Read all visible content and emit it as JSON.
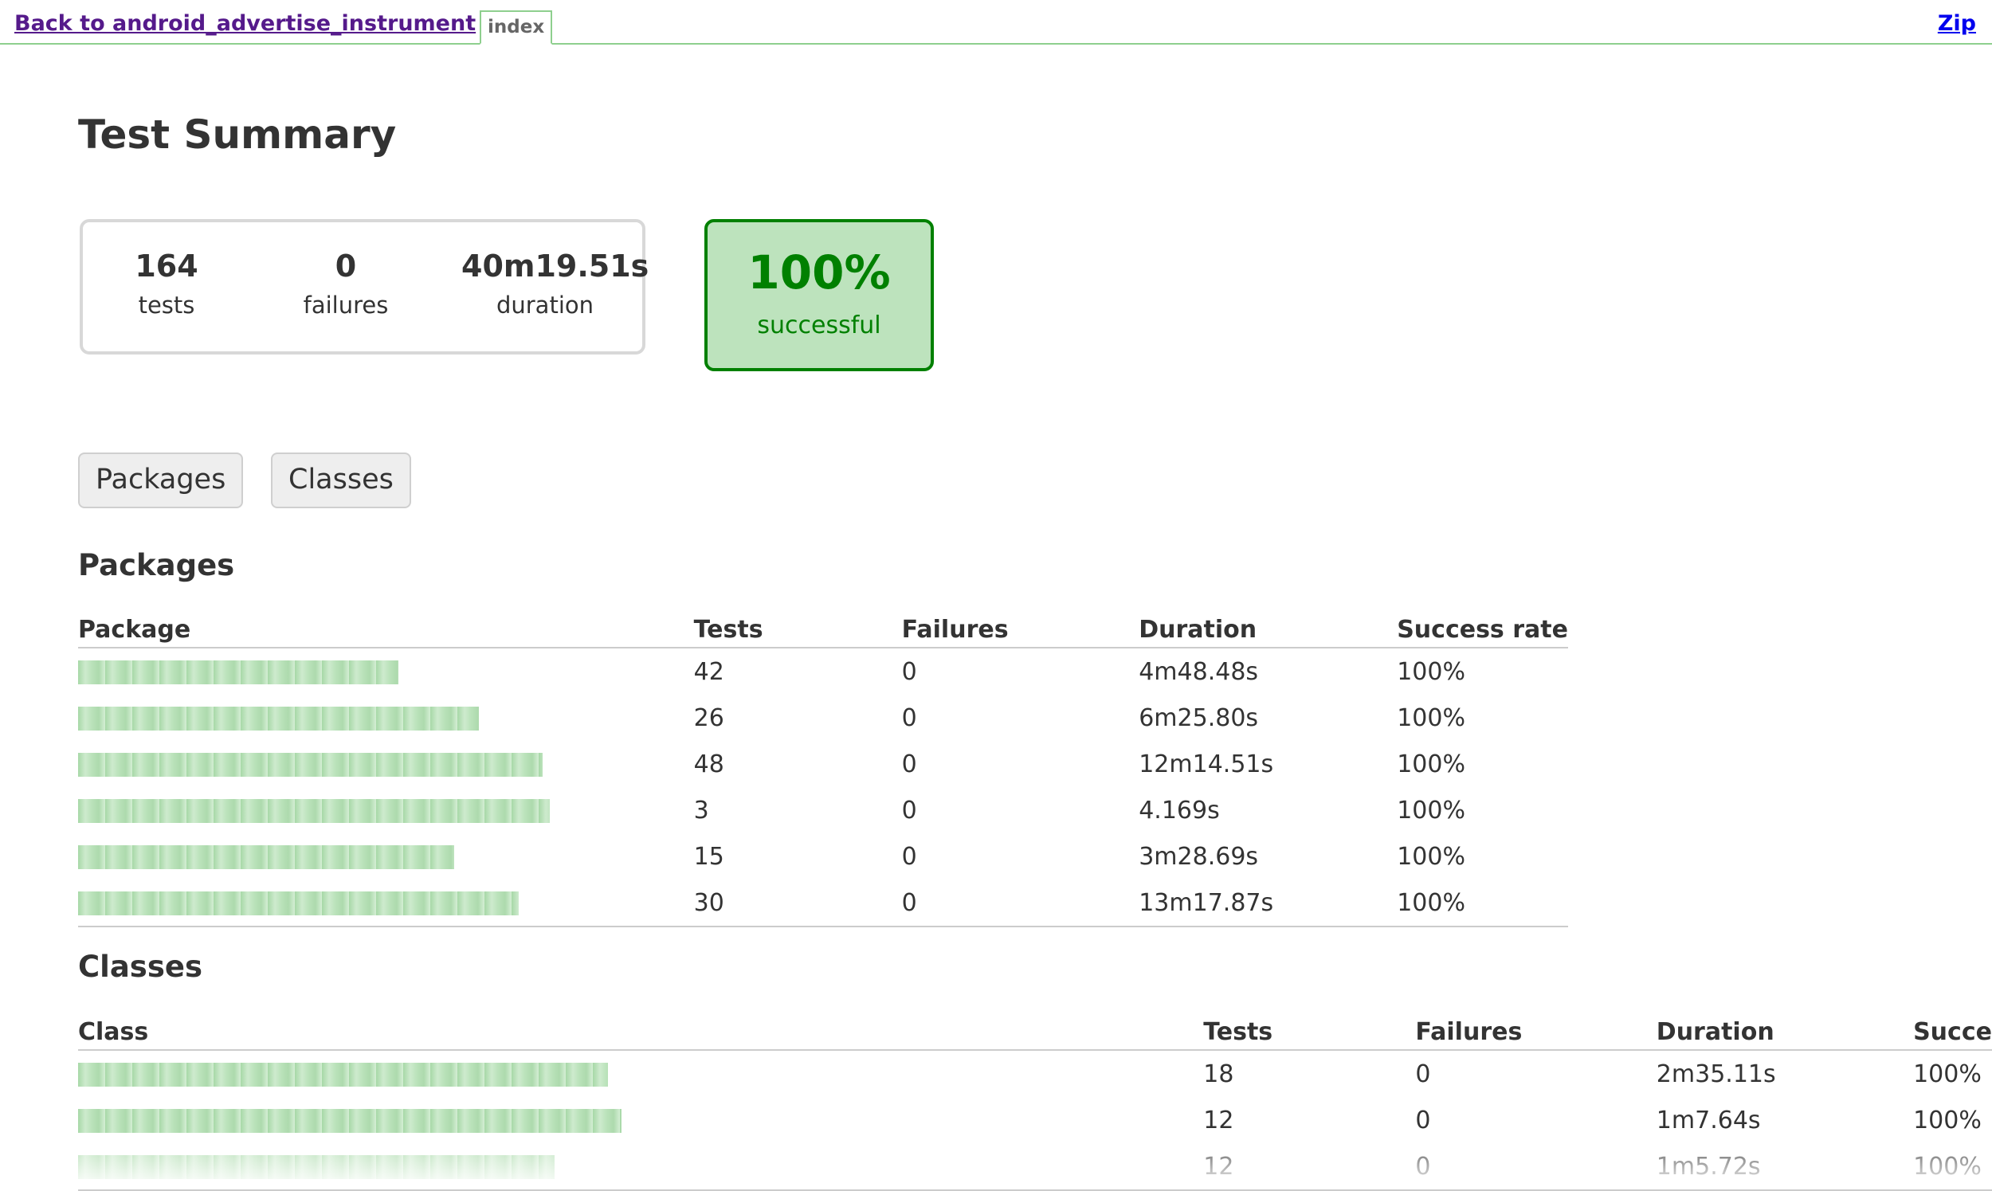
{
  "topbar": {
    "back_link": "Back to android_advertise_instrument",
    "tab_index": "index",
    "zip_link": "Zip"
  },
  "page_title": "Test Summary",
  "summary": {
    "tests": {
      "value": "164",
      "label": "tests"
    },
    "failures": {
      "value": "0",
      "label": "failures"
    },
    "duration": {
      "value": "40m19.51s",
      "label": "duration"
    },
    "success": {
      "value": "100%",
      "label": "successful"
    }
  },
  "tabs": [
    "Packages",
    "Classes"
  ],
  "packages": {
    "title": "Packages",
    "headers": [
      "Package",
      "Tests",
      "Failures",
      "Duration",
      "Success rate"
    ],
    "rows": [
      {
        "tests": "42",
        "failures": "0",
        "duration": "4m48.48s",
        "rate": "100%"
      },
      {
        "tests": "26",
        "failures": "0",
        "duration": "6m25.80s",
        "rate": "100%"
      },
      {
        "tests": "48",
        "failures": "0",
        "duration": "12m14.51s",
        "rate": "100%"
      },
      {
        "tests": "3",
        "failures": "0",
        "duration": "4.169s",
        "rate": "100%"
      },
      {
        "tests": "15",
        "failures": "0",
        "duration": "3m28.69s",
        "rate": "100%"
      },
      {
        "tests": "30",
        "failures": "0",
        "duration": "13m17.87s",
        "rate": "100%"
      }
    ]
  },
  "classes": {
    "title": "Classes",
    "headers": [
      "Class",
      "Tests",
      "Failures",
      "Duration",
      "Succe"
    ],
    "rows": [
      {
        "tests": "18",
        "failures": "0",
        "duration": "2m35.11s",
        "rate": "100%"
      },
      {
        "tests": "12",
        "failures": "0",
        "duration": "1m7.64s",
        "rate": "100%"
      },
      {
        "tests": "12",
        "failures": "0",
        "duration": "1m5.72s",
        "rate": "100%"
      }
    ]
  },
  "colors": {
    "success_green": "#008000",
    "success_bg": "#bde3bd",
    "topbar_border": "#8ecf8e",
    "back_link": "#551a8b",
    "zip_link": "#0000ee"
  }
}
